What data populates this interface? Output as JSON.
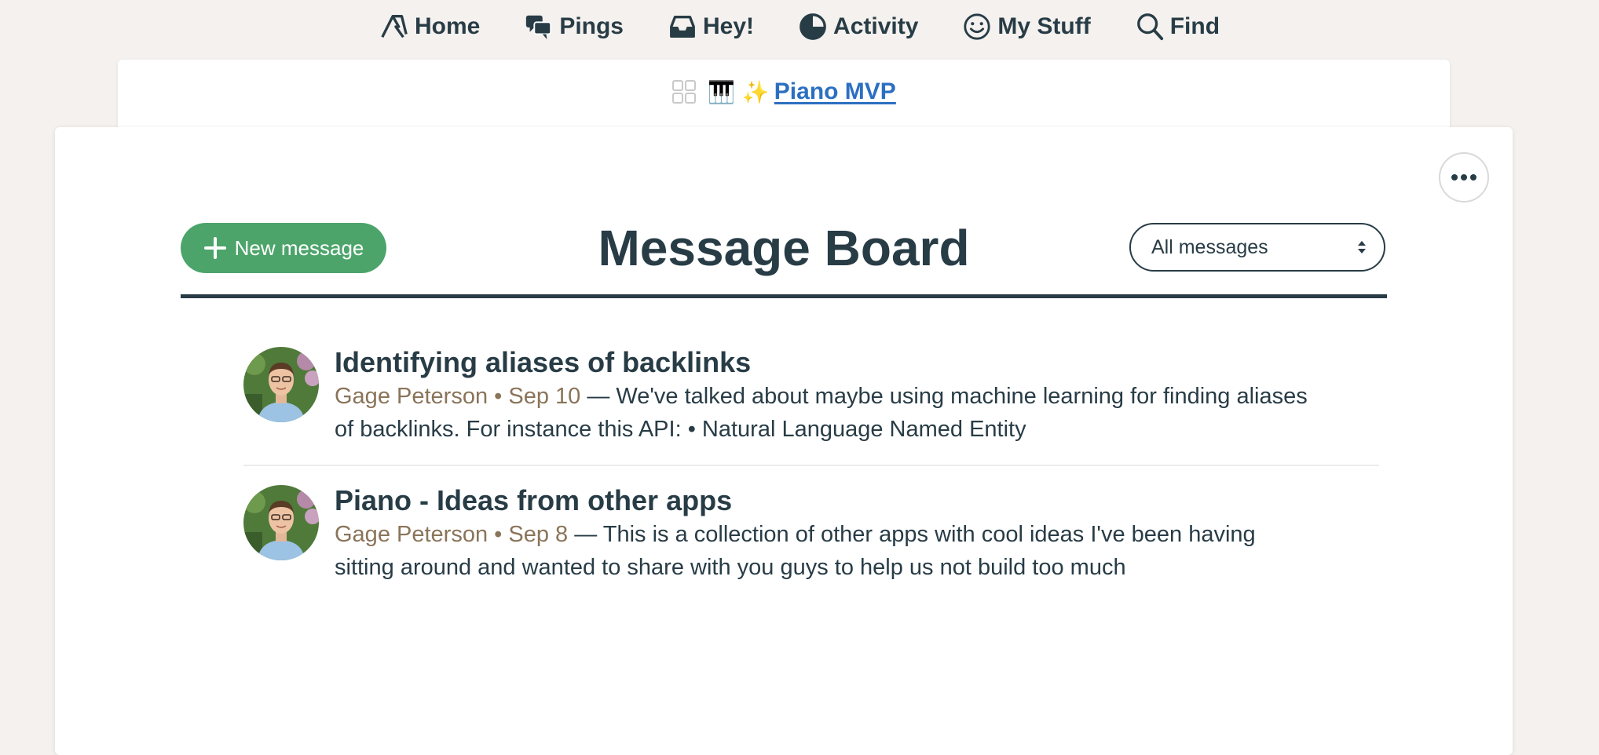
{
  "nav": {
    "items": [
      {
        "label": "Home",
        "icon": "home-icon"
      },
      {
        "label": "Pings",
        "icon": "pings-icon"
      },
      {
        "label": "Hey!",
        "icon": "hey-inbox-icon"
      },
      {
        "label": "Activity",
        "icon": "activity-icon"
      },
      {
        "label": "My Stuff",
        "icon": "smiley-icon"
      },
      {
        "label": "Find",
        "icon": "search-icon"
      }
    ]
  },
  "project": {
    "emoji": "🎹 ✨",
    "name": "Piano MVP"
  },
  "board": {
    "title": "Message Board",
    "new_message_label": "New message",
    "filter_value": "All messages"
  },
  "messages": [
    {
      "title": "Identifying aliases of backlinks",
      "author": "Gage Peterson",
      "date": "Sep 10",
      "excerpt": "We've talked about maybe using machine learning for finding aliases of backlinks. For instance this API:  • Natural Language Named Entity"
    },
    {
      "title": "Piano - Ideas from other apps",
      "author": "Gage Peterson",
      "date": "Sep 8",
      "excerpt": "This is a collection of other apps with cool ideas I've been having sitting around and wanted to share with you guys to help us not build too much"
    }
  ],
  "colors": {
    "text": "#283c46",
    "accent_green": "#4ca46a",
    "link_blue": "#2c6fc1",
    "meta_brown": "#8a7459",
    "background": "#f4f1ee"
  }
}
